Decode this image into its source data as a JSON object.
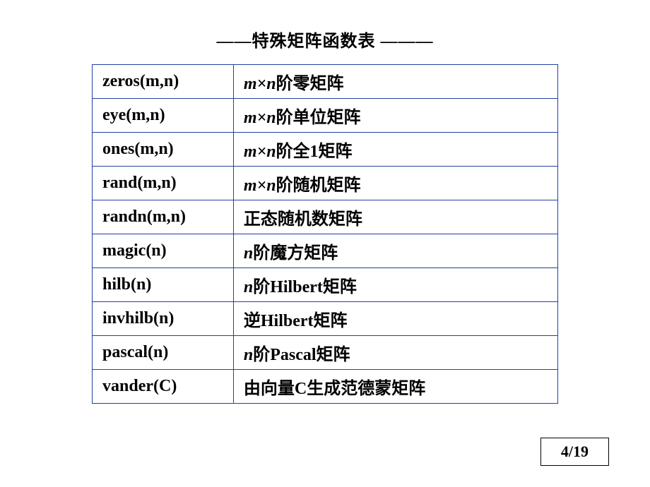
{
  "title_prefix": "——",
  "title_text": "特殊矩阵函数表",
  "title_suffix": " ———",
  "rows": [
    {
      "func": "zeros(m,n)",
      "desc_prefix_ital": "m×n",
      "desc_rest": "阶零矩阵"
    },
    {
      "func": "eye(m,n)",
      "desc_prefix_ital": "m×n",
      "desc_rest": "阶单位矩阵"
    },
    {
      "func": "ones(m,n)",
      "desc_prefix_ital": "m×n",
      "desc_rest": "阶全1矩阵"
    },
    {
      "func": "rand(m,n)",
      "desc_prefix_ital": "m×n",
      "desc_rest": "阶随机矩阵"
    },
    {
      "func": "randn(m,n)",
      "desc_prefix_ital": "",
      "desc_rest": "正态随机数矩阵"
    },
    {
      "func": "magic(n)",
      "desc_prefix_ital": "n",
      "desc_rest": "阶魔方矩阵"
    },
    {
      "func": "hilb(n)",
      "desc_prefix_ital": "n",
      "desc_rest": "阶Hilbert矩阵"
    },
    {
      "func": "invhilb(n)",
      "desc_prefix_ital": "",
      "desc_rest": "逆Hilbert矩阵"
    },
    {
      "func": "pascal(n)",
      "desc_prefix_ital": "n",
      "desc_rest": "阶Pascal矩阵"
    },
    {
      "func": "vander(C)",
      "desc_prefix_ital": "",
      "desc_rest": "由向量C生成范德蒙矩阵"
    }
  ],
  "page_number": "4/19"
}
